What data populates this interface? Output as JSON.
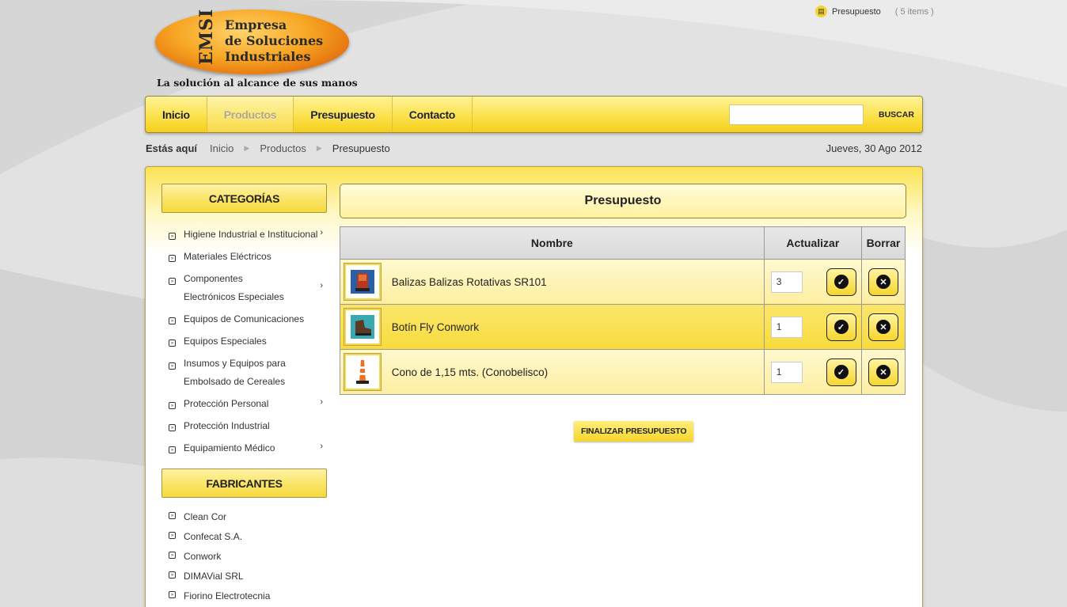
{
  "logo": {
    "acronym": "EMSI",
    "name_lines": [
      "Empresa",
      "de Soluciones",
      "Industriales"
    ],
    "slogan": "La solución al alcance de sus manos"
  },
  "cart_summary": {
    "label": "Presupuesto",
    "count": "( 5 items )"
  },
  "nav": {
    "items": [
      {
        "label": "Inicio",
        "active": false
      },
      {
        "label": "Productos",
        "active": true
      },
      {
        "label": "Presupuesto",
        "active": false
      },
      {
        "label": "Contacto",
        "active": false
      }
    ],
    "search_value": "",
    "search_button": "BUSCAR"
  },
  "breadcrumb": {
    "prefix": "Estás aquí",
    "items": [
      "Inicio",
      "Productos",
      "Presupuesto"
    ]
  },
  "date": "Jueves, 30 Ago 2012",
  "sidebar": {
    "categories_title": "CATEGORÍAS",
    "categories": [
      {
        "label": "Higiene Industrial e Institucional",
        "has_children": true
      },
      {
        "label": "Materiales Eléctricos",
        "has_children": false
      },
      {
        "label": "Componentes Electrónicos Especiales",
        "has_children": true
      },
      {
        "label": "Equipos de Comunicaciones",
        "has_children": false
      },
      {
        "label": "Equipos Especiales",
        "has_children": false
      },
      {
        "label": "Insumos y Equipos para Embolsado de Cereales",
        "has_children": false
      },
      {
        "label": "Protección Personal",
        "has_children": true
      },
      {
        "label": "Protección Industrial",
        "has_children": false
      },
      {
        "label": "Equipamiento Médico",
        "has_children": true
      }
    ],
    "manufacturers_title": "FABRICANTES",
    "manufacturers": [
      "Clean Cor",
      "Confecat S.A.",
      "Conwork",
      "DIMAVial SRL",
      "Fiorino Electrotecnia"
    ]
  },
  "content": {
    "title": "Presupuesto",
    "columns": {
      "name": "Nombre",
      "update": "Actualizar",
      "delete": "Borrar"
    },
    "rows": [
      {
        "name": "Balizas Balizas Rotativas SR101",
        "qty": "3",
        "thumb": "beacon-image"
      },
      {
        "name": "Botín Fly Conwork",
        "qty": "1",
        "thumb": "boot-image"
      },
      {
        "name": "Cono de 1,15 mts. (Conobelisco)",
        "qty": "1",
        "thumb": "cone-image"
      }
    ],
    "finalize_button": "FINALIZAR PRESUPUESTO"
  },
  "colors": {
    "accent": "#f8db3c",
    "accent_light": "#fff9cf",
    "border": "#9a9a9a"
  }
}
